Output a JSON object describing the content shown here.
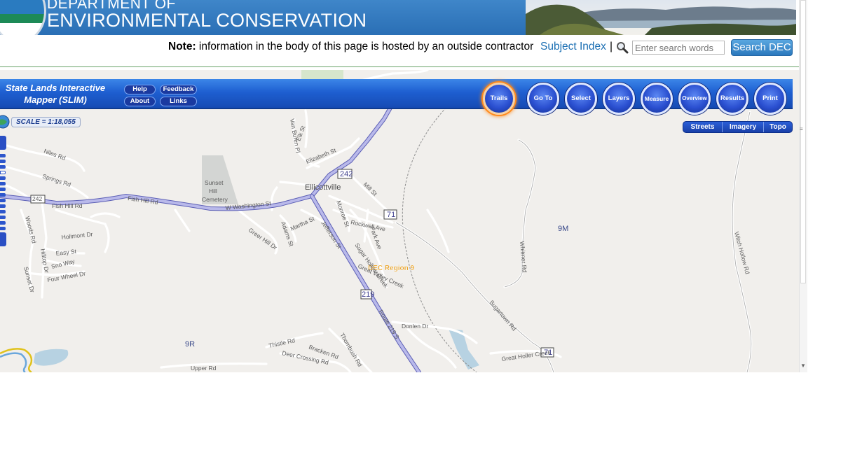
{
  "header": {
    "dept_line1": "DEPARTMENT OF",
    "dept_line2": "ENVIRONMENTAL CONSERVATION",
    "brand_color": "#2a6fb5"
  },
  "notice": {
    "label": "Note:",
    "text": " information in the body of this page is hosted by an outside contractor",
    "subject_index": "Subject Index",
    "separator": "|",
    "search_placeholder": "Enter search words",
    "search_button": "Search DEC"
  },
  "toolbar": {
    "app_title": "State Lands Interactive Mapper (SLIM)",
    "small_buttons": {
      "help": "Help",
      "feedback": "Feedback",
      "about": "About",
      "links": "Links"
    },
    "tools": [
      {
        "key": "trails",
        "label": "Trails",
        "active": true
      },
      {
        "key": "goto",
        "label": "Go To"
      },
      {
        "key": "select",
        "label": "Select"
      },
      {
        "key": "layers",
        "label": "Layers"
      },
      {
        "key": "measure",
        "label": "Measure"
      },
      {
        "key": "overview",
        "label": "Overview"
      },
      {
        "key": "results",
        "label": "Results"
      },
      {
        "key": "print",
        "label": "Print"
      }
    ],
    "base_layers": [
      "Streets",
      "Imagery",
      "Topo"
    ]
  },
  "map": {
    "scale_text": "SCALE = 1:18,055",
    "town": "Ellicottville",
    "cemetery": [
      "Sunset",
      "Hill",
      "Cemetery"
    ],
    "region_label": "DEC Region 9",
    "zones": {
      "east": "9M",
      "southwest": "9R"
    },
    "highways": {
      "h242": "242",
      "h71a": "71",
      "h219": "219",
      "h71b": "71",
      "h242w": "242"
    },
    "roads": {
      "niles": "Niles Rd",
      "springs": "Springs Rd",
      "fish_hill_1": "Fish Hill Rd",
      "fish_hill_2": "Fish Hill Rd",
      "w_washington": "W Washington St",
      "jefferson": "Jefferson St",
      "route219": "Route 219 S",
      "elizabeth": "Elizabeth St",
      "mill": "Mill St",
      "monroe": "Monroe St",
      "rockwell": "Rockwell Ave",
      "park": "Park Ave",
      "martha": "Martha St",
      "adams": "Adams St",
      "greer_hill": "Greer Hill Dr",
      "holimont": "Holimont Dr",
      "easy": "Easy St",
      "sno_way": "Sno Way",
      "four_wheel": "Four Wheel Dr",
      "woods": "Woods Rd",
      "hilltop": "Hilltop Dr",
      "sunset": "Sunset Dr",
      "van_buren": "Van Buren Pl",
      "elk": "Elk St",
      "sugartown": "Sugartown Rd",
      "whitmer": "Whitmer Rd",
      "witch_hollow": "Witch Hollow Rd",
      "donlen": "Donlen Dr",
      "thistle": "Thistle Rd",
      "bracken": "Bracken Rd",
      "deer_crossing": "Deer Crossing Rd",
      "thornbush": "Thornbush Rd",
      "upper": "Upper Rd",
      "sugar_hollow": "Sugar Hollow Creek",
      "great_valley": "Great Valley Creek",
      "great_holler": "Great Holler Creek"
    }
  }
}
